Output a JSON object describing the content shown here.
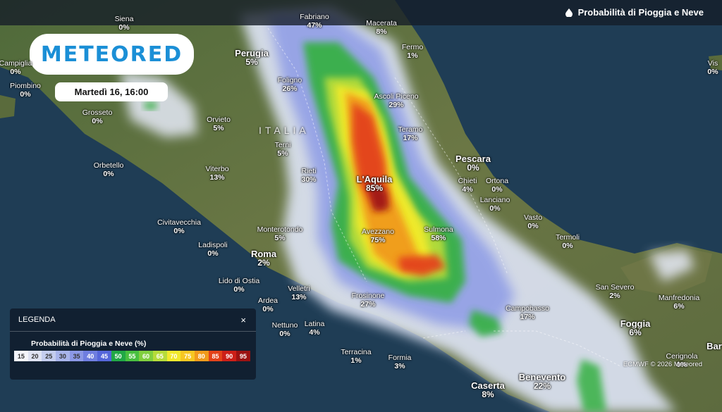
{
  "header": {
    "title": "Probabilità di Pioggia e Neve",
    "icon": "water-drop-icon"
  },
  "brand": {
    "logo": "METEORED",
    "color": "#1b8fd6"
  },
  "date_label": "Martedì 16, 16:00",
  "region_label": "ITALIA",
  "cities": [
    {
      "id": "siena",
      "name": "Siena",
      "value": "0%"
    },
    {
      "id": "fabriano",
      "name": "Fabriano",
      "value": "47%"
    },
    {
      "id": "macerata",
      "name": "Macerata",
      "value": "8%"
    },
    {
      "id": "perugia",
      "name": "Perugia",
      "value": "5%"
    },
    {
      "id": "fermo",
      "name": "Fermo",
      "value": "1%"
    },
    {
      "id": "campiglia",
      "name": "Campiglia",
      "value": "0%"
    },
    {
      "id": "piombino",
      "name": "Piombino",
      "value": "0%"
    },
    {
      "id": "foligno",
      "name": "Foligno",
      "value": "26%"
    },
    {
      "id": "ascoli",
      "name": "Ascoli Piceno",
      "value": "29%"
    },
    {
      "id": "grosseto",
      "name": "Grosseto",
      "value": "0%"
    },
    {
      "id": "orvieto",
      "name": "Orvieto",
      "value": "5%"
    },
    {
      "id": "teramo",
      "name": "Teramo",
      "value": "17%"
    },
    {
      "id": "terni",
      "name": "Terni",
      "value": "5%"
    },
    {
      "id": "pescara",
      "name": "Pescara",
      "value": "0%"
    },
    {
      "id": "orbetello",
      "name": "Orbetello",
      "value": "0%"
    },
    {
      "id": "viterbo",
      "name": "Viterbo",
      "value": "13%"
    },
    {
      "id": "rieti",
      "name": "Rieti",
      "value": "30%"
    },
    {
      "id": "laquila",
      "name": "L'Aquila",
      "value": "85%"
    },
    {
      "id": "chieti",
      "name": "Chieti",
      "value": "4%"
    },
    {
      "id": "ortona",
      "name": "Ortona",
      "value": "0%"
    },
    {
      "id": "lanciano",
      "name": "Lanciano",
      "value": "0%"
    },
    {
      "id": "vasto",
      "name": "Vasto",
      "value": "0%"
    },
    {
      "id": "civitavecchia",
      "name": "Civitavecchia",
      "value": "0%"
    },
    {
      "id": "monterotondo",
      "name": "Monterotondo",
      "value": "5%"
    },
    {
      "id": "avezzano",
      "name": "Avezzano",
      "value": "75%"
    },
    {
      "id": "sulmona",
      "name": "Sulmona",
      "value": "58%"
    },
    {
      "id": "termoli",
      "name": "Termoli",
      "value": "0%"
    },
    {
      "id": "ladispoli",
      "name": "Ladispoli",
      "value": "0%"
    },
    {
      "id": "roma",
      "name": "Roma",
      "value": "2%"
    },
    {
      "id": "lido",
      "name": "Lido di Ostia",
      "value": "0%"
    },
    {
      "id": "sansevero",
      "name": "San Severo",
      "value": "2%"
    },
    {
      "id": "velletri",
      "name": "Velletri",
      "value": "13%"
    },
    {
      "id": "frosinone",
      "name": "Frosinone",
      "value": "27%"
    },
    {
      "id": "manfredonia",
      "name": "Manfredonia",
      "value": "6%"
    },
    {
      "id": "ardea",
      "name": "Ardea",
      "value": "0%"
    },
    {
      "id": "campobasso",
      "name": "Campobasso",
      "value": "17%"
    },
    {
      "id": "latina",
      "name": "Latina",
      "value": "4%"
    },
    {
      "id": "nettuno",
      "name": "Nettuno",
      "value": "0%"
    },
    {
      "id": "foggia",
      "name": "Foggia",
      "value": "6%"
    },
    {
      "id": "terracina",
      "name": "Terracina",
      "value": "1%"
    },
    {
      "id": "formia",
      "name": "Formia",
      "value": "3%"
    },
    {
      "id": "cerignola",
      "name": "Cerignola",
      "value": "0%"
    },
    {
      "id": "benevento",
      "name": "Benevento",
      "value": "22%"
    },
    {
      "id": "caserta",
      "name": "Caserta",
      "value": "8%"
    },
    {
      "id": "vis",
      "name": "Vis",
      "value": "0%"
    },
    {
      "id": "bar",
      "name": "Bar",
      "value": ""
    }
  ],
  "legend": {
    "title": "LEGENDA",
    "close": "×",
    "subtitle": "Probabilità di Pioggia e Neve (%)",
    "scale": [
      {
        "label": "15",
        "color": "#f4f5fb"
      },
      {
        "label": "20",
        "color": "#dfe3f3"
      },
      {
        "label": "25",
        "color": "#c4cdee"
      },
      {
        "label": "30",
        "color": "#a8b4ea"
      },
      {
        "label": "35",
        "color": "#8b98e6"
      },
      {
        "label": "40",
        "color": "#6f7ee0"
      },
      {
        "label": "45",
        "color": "#5566db"
      },
      {
        "label": "50",
        "color": "#21a845"
      },
      {
        "label": "55",
        "color": "#48bf3f"
      },
      {
        "label": "60",
        "color": "#80cf3e"
      },
      {
        "label": "65",
        "color": "#b6dc3a"
      },
      {
        "label": "70",
        "color": "#f2ea2c"
      },
      {
        "label": "75",
        "color": "#f6c722"
      },
      {
        "label": "80",
        "color": "#f19a1c"
      },
      {
        "label": "85",
        "color": "#e3421a"
      },
      {
        "label": "90",
        "color": "#cc1f18"
      },
      {
        "label": "95",
        "color": "#9b1212"
      }
    ]
  },
  "credit": "ECMWF © 2026 Meteored"
}
